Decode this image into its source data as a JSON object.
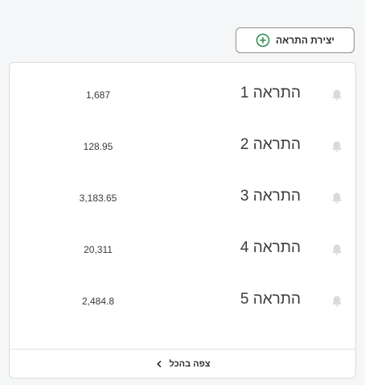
{
  "header": {
    "create_label": "יצירת התראה",
    "create_icon": "plus-circle-icon",
    "accent_color": "#2a8c4a"
  },
  "alerts": [
    {
      "name": "התראה 1",
      "value": "1,687",
      "icon": "bell-icon"
    },
    {
      "name": "התראה 2",
      "value": "128.95",
      "icon": "bell-icon"
    },
    {
      "name": "התראה 3",
      "value": "3,183.65",
      "icon": "bell-icon"
    },
    {
      "name": "התראה 4",
      "value": "20,311",
      "icon": "bell-icon"
    },
    {
      "name": "התראה 5",
      "value": "2,484.8",
      "icon": "bell-icon"
    }
  ],
  "footer": {
    "view_all_label": "צפה בהכל",
    "view_all_icon": "chevron-left-icon"
  }
}
